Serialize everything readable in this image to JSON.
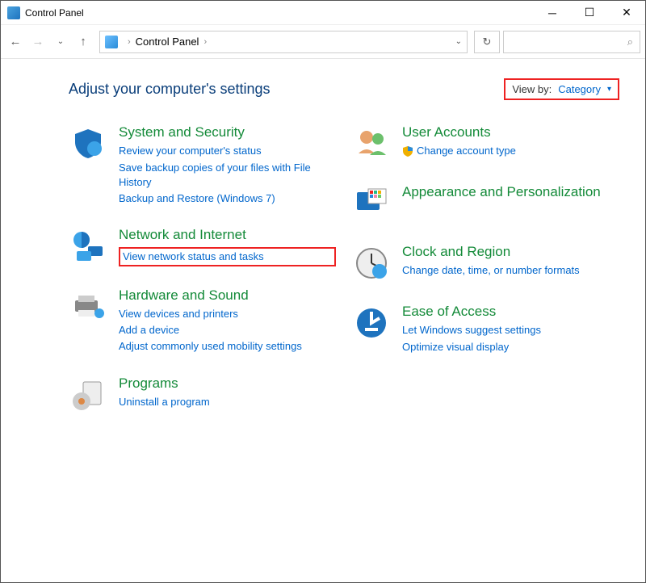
{
  "window": {
    "title": "Control Panel"
  },
  "address": {
    "root": "Control Panel"
  },
  "header": {
    "title": "Adjust your computer's settings"
  },
  "viewby": {
    "label": "View by:",
    "value": "Category"
  },
  "categories": {
    "system": {
      "title": "System and Security",
      "links": [
        "Review your computer's status",
        "Save backup copies of your files with File History",
        "Backup and Restore (Windows 7)"
      ]
    },
    "network": {
      "title": "Network and Internet",
      "links": [
        "View network status and tasks"
      ]
    },
    "hardware": {
      "title": "Hardware and Sound",
      "links": [
        "View devices and printers",
        "Add a device",
        "Adjust commonly used mobility settings"
      ]
    },
    "programs": {
      "title": "Programs",
      "links": [
        "Uninstall a program"
      ]
    },
    "users": {
      "title": "User Accounts",
      "links": [
        "Change account type"
      ]
    },
    "appearance": {
      "title": "Appearance and Personalization",
      "links": []
    },
    "clock": {
      "title": "Clock and Region",
      "links": [
        "Change date, time, or number formats"
      ]
    },
    "access": {
      "title": "Ease of Access",
      "links": [
        "Let Windows suggest settings",
        "Optimize visual display"
      ]
    }
  }
}
